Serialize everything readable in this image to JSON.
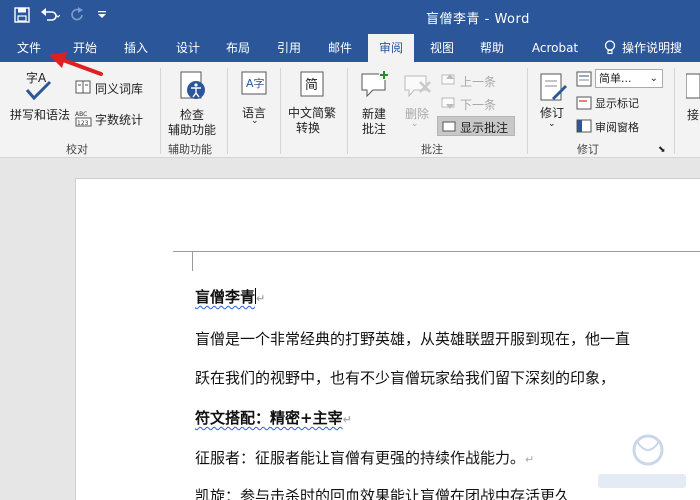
{
  "qat": {
    "save": "save-icon",
    "undo": "undo-icon",
    "redo": "redo-icon",
    "customize": "customize-qat-icon"
  },
  "title": "盲僧李青 - Word",
  "tabs": [
    {
      "label": "文件"
    },
    {
      "label": "开始"
    },
    {
      "label": "插入"
    },
    {
      "label": "设计"
    },
    {
      "label": "布局"
    },
    {
      "label": "引用"
    },
    {
      "label": "邮件"
    },
    {
      "label": "审阅"
    },
    {
      "label": "视图"
    },
    {
      "label": "帮助"
    },
    {
      "label": "Acrobat"
    },
    {
      "label": "操作说明搜"
    }
  ],
  "active_tab": "审阅",
  "ribbon": {
    "proofing": {
      "spell": "拼写和语法",
      "thesaurus": "同义词库",
      "wordcount": "字数统计",
      "label": "校对"
    },
    "accessibility": {
      "check": "检查",
      "check2": "辅助功能",
      "label": "辅助功能"
    },
    "language": {
      "lang": "语言",
      "label": ""
    },
    "chinese": {
      "convert": "中文简繁",
      "convert2": "转换"
    },
    "comments": {
      "new": "新建",
      "new2": "批注",
      "delete": "删除",
      "prev": "上一条",
      "next": "下一条",
      "show": "显示批注",
      "label": "批注"
    },
    "tracking": {
      "track": "修订",
      "view_select": "简单...",
      "show_markup": "显示标记",
      "pane": "审阅窗格",
      "label": "修订"
    },
    "accept": {
      "label": "接"
    }
  },
  "document": {
    "title": "盲僧李青",
    "p1": "盲僧是一个非常经典的打野英雄，从英雄联盟开服到现在，他一直",
    "p2": "跃在我们的视野中，也有不少盲僧玩家给我们留下深刻的印象，",
    "h2": "符文搭配：精密+主宰",
    "p3": "征服者：征服者能让盲僧有更强的持续作战能力。",
    "p4": "凯旋：参与击杀时的回血效果能让盲僧在团战中存活更久"
  },
  "colors": {
    "accent": "#2b579a",
    "arrow": "#e02020"
  }
}
